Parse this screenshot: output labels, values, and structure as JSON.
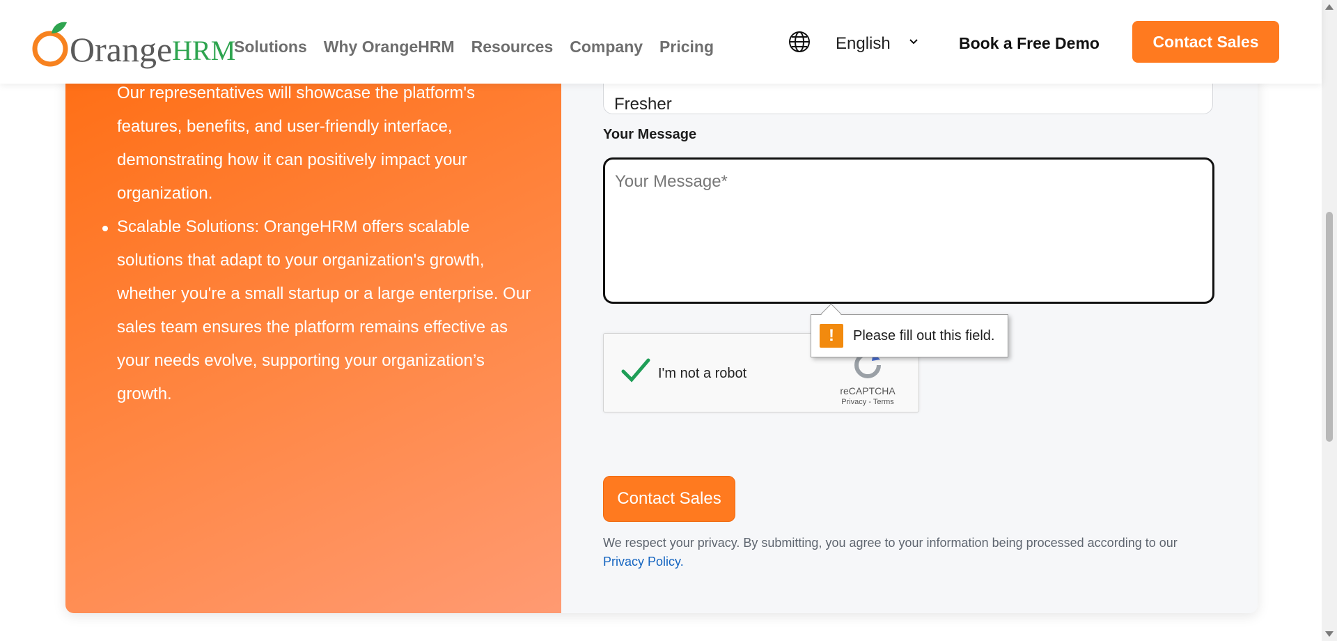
{
  "header": {
    "logo": {
      "part1": "Orange",
      "part2": "HRM"
    },
    "nav": [
      "Solutions",
      "Why OrangeHRM",
      "Resources",
      "Company",
      "Pricing"
    ],
    "language": "English",
    "demo_link": "Book a Free Demo",
    "contact_button": "Contact Sales"
  },
  "left_panel": {
    "paragraph": "Our representatives will showcase the platform's features, benefits, and user-friendly interface, demonstrating how it can positively impact your organization.",
    "bullet": "Scalable Solutions: OrangeHRM offers scalable solutions that adapt to your organization's growth, whether you're a small startup or a large enterprise. Our sales team ensures the platform remains effective as your needs evolve, supporting your organization’s growth."
  },
  "form": {
    "experience_value": "Fresher",
    "message_label": "Your Message",
    "message_placeholder": "Your Message*",
    "tooltip": "Please fill out this field.",
    "recaptcha": {
      "label": "I'm not a robot",
      "brand": "reCAPTCHA",
      "privacy": "Privacy",
      "separator": " - ",
      "terms": "Terms"
    },
    "submit_button": "Contact Sales",
    "privacy_text": "We respect your privacy. By submitting, you agree to your information being processed according to our ",
    "privacy_link": "Privacy Policy."
  },
  "colors": {
    "accent": "#ff7a1f",
    "brand_green": "#2ea44f",
    "link": "#1565c0"
  },
  "icons": [
    "globe-icon",
    "chevron-down-icon",
    "warning-icon",
    "checkmark-icon",
    "recaptcha-logo-icon"
  ]
}
